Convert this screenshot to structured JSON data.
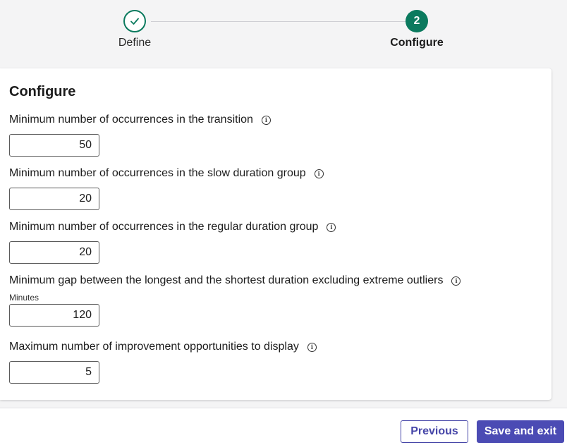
{
  "stepper": {
    "steps": [
      {
        "label": "Define",
        "state": "completed",
        "icon": "check-icon"
      },
      {
        "label": "Configure",
        "state": "active",
        "number": "2"
      }
    ],
    "accent_color": "#0b7a5e"
  },
  "card": {
    "title": "Configure",
    "fields": [
      {
        "label": "Minimum number of occurrences in the transition",
        "value": "50",
        "unit": ""
      },
      {
        "label": "Minimum number of occurrences in the slow duration group",
        "value": "20",
        "unit": ""
      },
      {
        "label": "Minimum number of occurrences in the regular duration group",
        "value": "20",
        "unit": ""
      },
      {
        "label": "Minimum gap between the longest and the shortest duration excluding extreme outliers",
        "value": "120",
        "unit": "Minutes"
      },
      {
        "label": "Maximum number of improvement opportunities to display",
        "value": "5",
        "unit": ""
      }
    ]
  },
  "footer": {
    "previous_label": "Previous",
    "save_label": "Save and exit",
    "primary_color": "#4b4bb4"
  }
}
